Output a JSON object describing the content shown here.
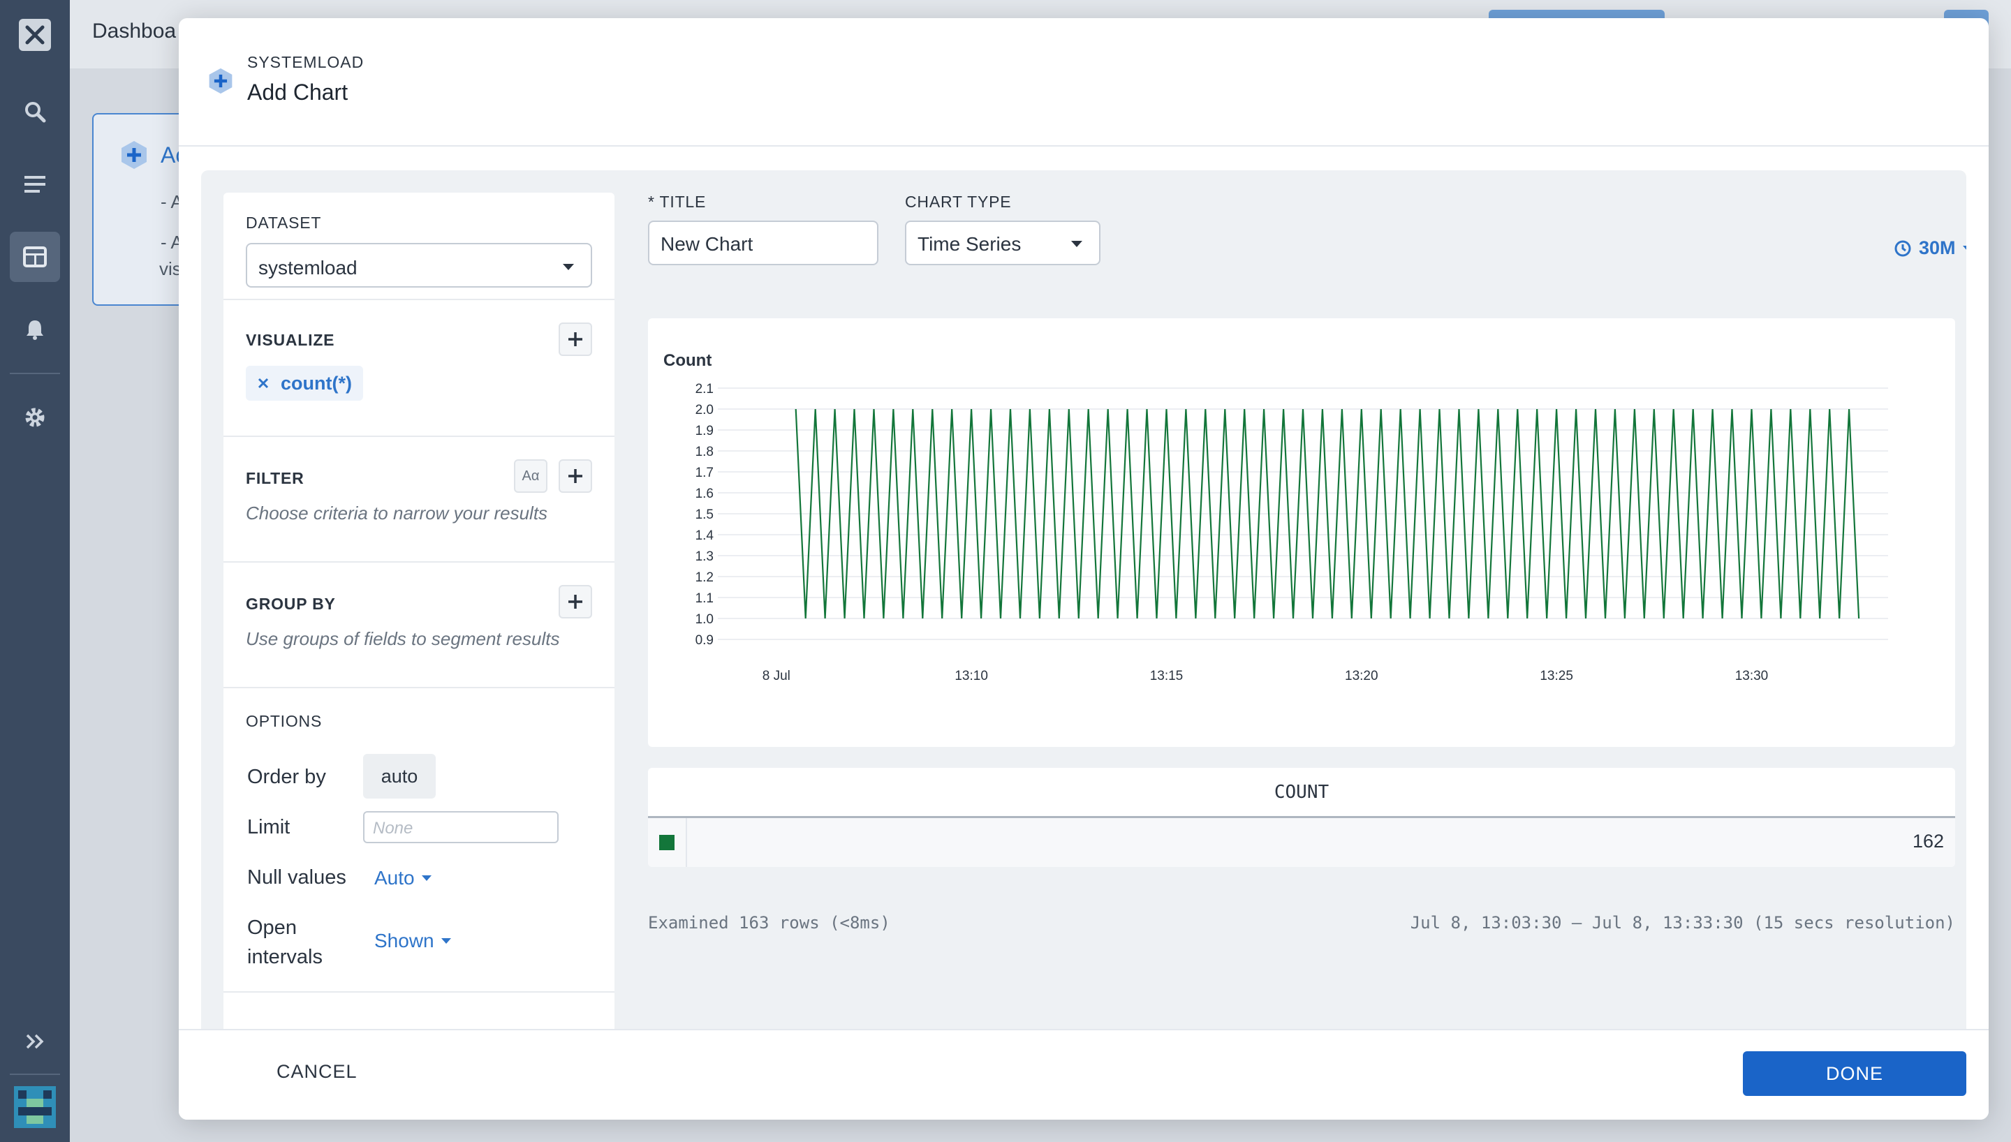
{
  "background": {
    "page_title": "Dashboa",
    "card": {
      "title": "Ac",
      "line1": "- A",
      "line2": "- A",
      "line3": "vis"
    }
  },
  "modal": {
    "kicker": "SYSTEMLOAD",
    "title": "Add Chart",
    "query": {
      "dataset_label": "DATASET",
      "dataset_value": "systemload",
      "visualize_label": "VISUALIZE",
      "visualize_chip": "count(*)",
      "filter_label": "FILTER",
      "filter_aa": "Aα",
      "filter_hint": "Choose criteria to narrow your results",
      "groupby_label": "GROUP BY",
      "groupby_hint": "Use groups of fields to segment results",
      "options_label": "OPTIONS",
      "order_by_label": "Order by",
      "order_by_value": "auto",
      "limit_label": "Limit",
      "limit_placeholder": "None",
      "null_values_label": "Null values",
      "null_values_value": "Auto",
      "open_intervals_label_1": "Open",
      "open_intervals_label_2": "intervals",
      "open_intervals_value": "Shown"
    },
    "form": {
      "title_label": "* TITLE",
      "title_value": "New Chart",
      "chart_type_label": "CHART TYPE",
      "chart_type_value": "Time Series",
      "time_range": "30M"
    },
    "table": {
      "header": "COUNT",
      "value": "162"
    },
    "footer": {
      "examined": "Examined 163 rows (<8ms)",
      "range": "Jul 8, 13:03:30 — Jul 8, 13:33:30 (15 secs resolution)"
    },
    "buttons": {
      "cancel": "CANCEL",
      "done": "DONE"
    }
  },
  "colors": {
    "rail": "#3a4a60",
    "accent": "#1a64c8",
    "series": "#13763a"
  },
  "chart_data": {
    "type": "line",
    "title": "",
    "ylabel": "Count",
    "xlabel": "",
    "ylim": [
      0.9,
      2.1
    ],
    "y_ticks": [
      "2.1",
      "2.0",
      "1.9",
      "1.8",
      "1.7",
      "1.6",
      "1.5",
      "1.4",
      "1.3",
      "1.2",
      "1.1",
      "1.0",
      "0.9"
    ],
    "x_ticks": [
      "8 Jul",
      "13:10",
      "13:15",
      "13:20",
      "13:25",
      "13:30"
    ],
    "grid": true,
    "series": [
      {
        "color": "#13763a",
        "pattern": "alternating",
        "high": 2,
        "low": 1,
        "start": "13:05:30",
        "end": "13:32:45",
        "interval_seconds": 15,
        "first_value": 2
      }
    ]
  }
}
